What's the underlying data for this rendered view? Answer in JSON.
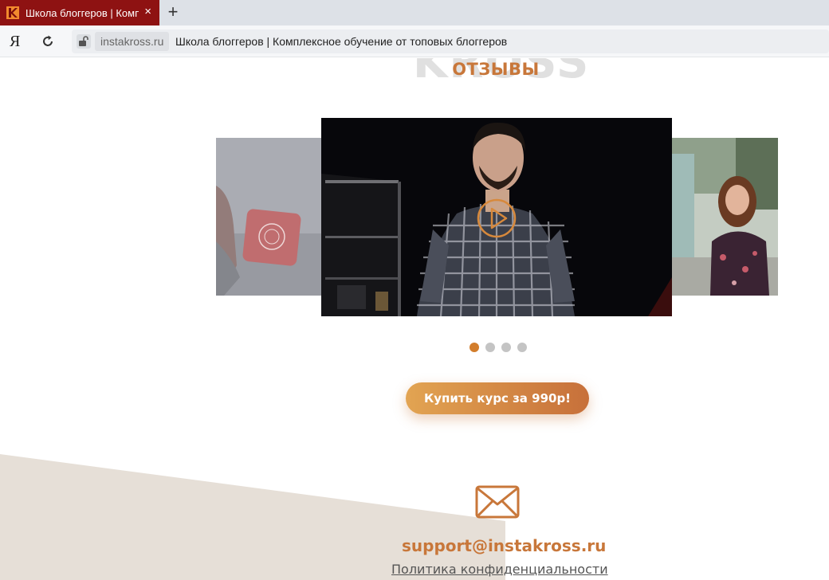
{
  "browser": {
    "tab_title": "Школа блоггеров | Комплексное обучение от топовых блоггеров",
    "tab_close": "×",
    "new_tab": "+",
    "yandex_button": "Я",
    "domain": "instakross.ru",
    "page_title": "Школа блоггеров | Комплексное обучение от топовых блоггеров",
    "accent_color": "#8e1212"
  },
  "page": {
    "background_word": "KROSS",
    "section_title": "ОТЗЫВЫ",
    "carousel": {
      "slide_count": 4,
      "active_index": 0
    },
    "buy_button": "Купить курс за 990р!",
    "support_email": "support@instakross.ru",
    "privacy_link": "Политика конфиденциальности",
    "accent_color": "#c8773a"
  }
}
